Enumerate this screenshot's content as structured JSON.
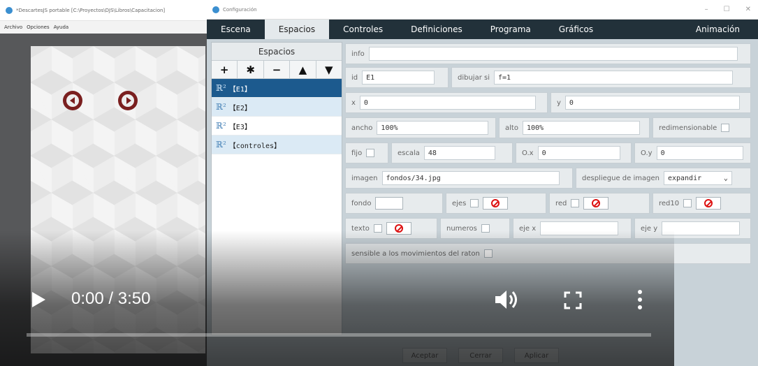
{
  "background_window": {
    "title": "*DescartesJS portable [C:\\Proyectos\\DJS\\Libros\\Capacitacion]",
    "menu": [
      "Archivo",
      "Opciones",
      "Ayuda"
    ]
  },
  "config_window": {
    "title": "Configuración",
    "controls": [
      "–",
      "☐",
      "✕"
    ],
    "tabs": [
      "Escena",
      "Espacios",
      "Controles",
      "Definiciones",
      "Programa",
      "Gráficos"
    ],
    "active_tab": "Espacios",
    "right_tab": "Animación"
  },
  "spaces_panel": {
    "header": "Espacios",
    "tools": [
      "+",
      "✱",
      "−",
      "▲",
      "▼"
    ],
    "r2_symbol": "ℝ²",
    "items": [
      {
        "label": "【E1】",
        "selected": true
      },
      {
        "label": "【E2】",
        "selected": false
      },
      {
        "label": "【E3】",
        "selected": false
      },
      {
        "label": "【controles】",
        "selected": false
      }
    ]
  },
  "form": {
    "info_label": "info",
    "info_value": "",
    "id_label": "id",
    "id_value": "E1",
    "dibujar_si_label": "dibujar si",
    "dibujar_si_value": "f=1",
    "x_label": "x",
    "x_value": "0",
    "y_label": "y",
    "y_value": "0",
    "ancho_label": "ancho",
    "ancho_value": "100%",
    "alto_label": "alto",
    "alto_value": "100%",
    "redimensionable_label": "redimensionable",
    "fijo_label": "fijo",
    "escala_label": "escala",
    "escala_value": "48",
    "ox_label": "O.x",
    "ox_value": "0",
    "oy_label": "O.y",
    "oy_value": "0",
    "imagen_label": "imagen",
    "imagen_value": "fondos/34.jpg",
    "despliegue_label": "despliegue de imagen",
    "despliegue_value": "expandir",
    "fondo_label": "fondo",
    "ejes_label": "ejes",
    "red_label": "red",
    "red10_label": "red10",
    "texto_label": "texto",
    "numeros_label": "numeros",
    "eje_x_label": "eje x",
    "eje_y_label": "eje y",
    "sensible_label": "sensible a los movimientos del raton"
  },
  "footer_buttons": [
    "Aceptar",
    "Cerrar",
    "Aplicar"
  ],
  "video": {
    "time": "0:00 / 3:50",
    "progress": 0
  },
  "colors": {
    "tab_bar": "#22313a",
    "selected_item": "#1c5a8e",
    "nav_button": "#7a1f1f",
    "progress": "#ff0000"
  }
}
